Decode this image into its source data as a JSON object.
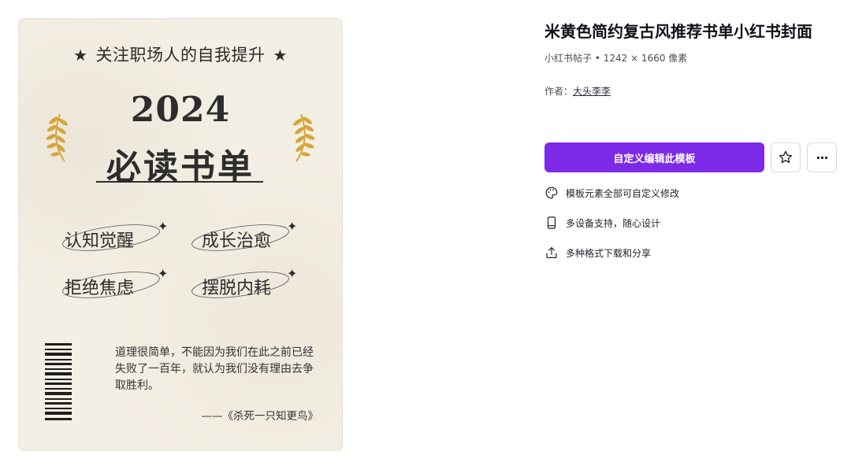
{
  "preview": {
    "top_line": "关注职场人的自我提升",
    "star": "★",
    "year": "2024",
    "title": "必读书单",
    "keywords": [
      "认知觉醒",
      "成长治愈",
      "拒绝焦虑",
      "摆脱内耗"
    ],
    "sparkle": "✦",
    "quote": "道理很简单，不能因为我们在此之前已经失败了一百年，就认为我们没有理由去争取胜利。",
    "quote_source": "——《杀死一只知更鸟》",
    "laurel_color": "#d4a63a",
    "background_color": "#f4efe4"
  },
  "info": {
    "title": "米黄色简约复古风推荐书单小红书封面",
    "meta": "小红书帖子 • 1242 × 1660 像素",
    "author_label": "作者：",
    "author_name": "大头李李",
    "customize_button": "自定义编辑此模板",
    "more_icon": "···",
    "accent_color": "#7d2ae8",
    "features": [
      {
        "icon": "palette-icon",
        "text": "模板元素全部可自定义修改"
      },
      {
        "icon": "phone-icon",
        "text": "多设备支持，随心设计"
      },
      {
        "icon": "share-icon",
        "text": "多种格式下载和分享"
      }
    ]
  }
}
